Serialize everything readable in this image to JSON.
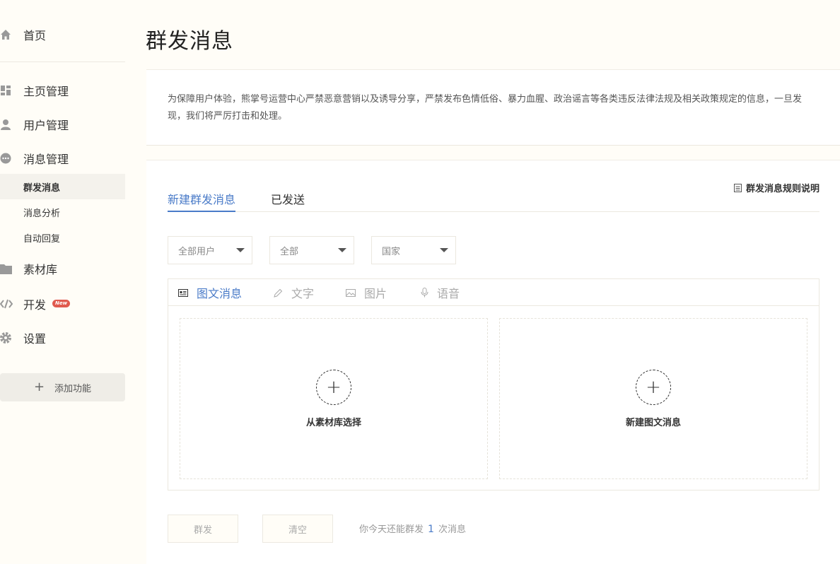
{
  "sidebar": {
    "home": "首页",
    "homepage_mgmt": "主页管理",
    "user_mgmt": "用户管理",
    "message_mgmt": "消息管理",
    "mass_message": "群发消息",
    "message_analysis": "消息分析",
    "auto_reply": "自动回复",
    "materials": "素材库",
    "develop": "开发",
    "new_badge": "New",
    "settings": "设置",
    "add_feature": "添加功能"
  },
  "page": {
    "title": "群发消息",
    "notice": "为保障用户体验，熊掌号运营中心严禁恶意营销以及诱导分享，严禁发布色情低俗、暴力血腥、政治谣言等各类违反法律法规及相关政策规定的信息，一旦发现，我们将严厉打击和处理。"
  },
  "tabs": {
    "new": "新建群发消息",
    "sent": "已发送",
    "rules": "群发消息规则说明"
  },
  "filters": {
    "users": "全部用户",
    "gender": "全部",
    "country": "国家"
  },
  "types": {
    "news": "图文消息",
    "text": "文字",
    "image": "图片",
    "voice": "语音"
  },
  "drop": {
    "from_library": "从素材库选择",
    "create_news": "新建图文消息"
  },
  "actions": {
    "send": "群发",
    "clear": "清空",
    "quota_prefix": "你今天还能群发",
    "quota_count": "1",
    "quota_suffix": "次消息"
  },
  "colors": {
    "accent": "#4a7bc8",
    "badge": "#e05a4f",
    "background": "#fffdf7"
  }
}
